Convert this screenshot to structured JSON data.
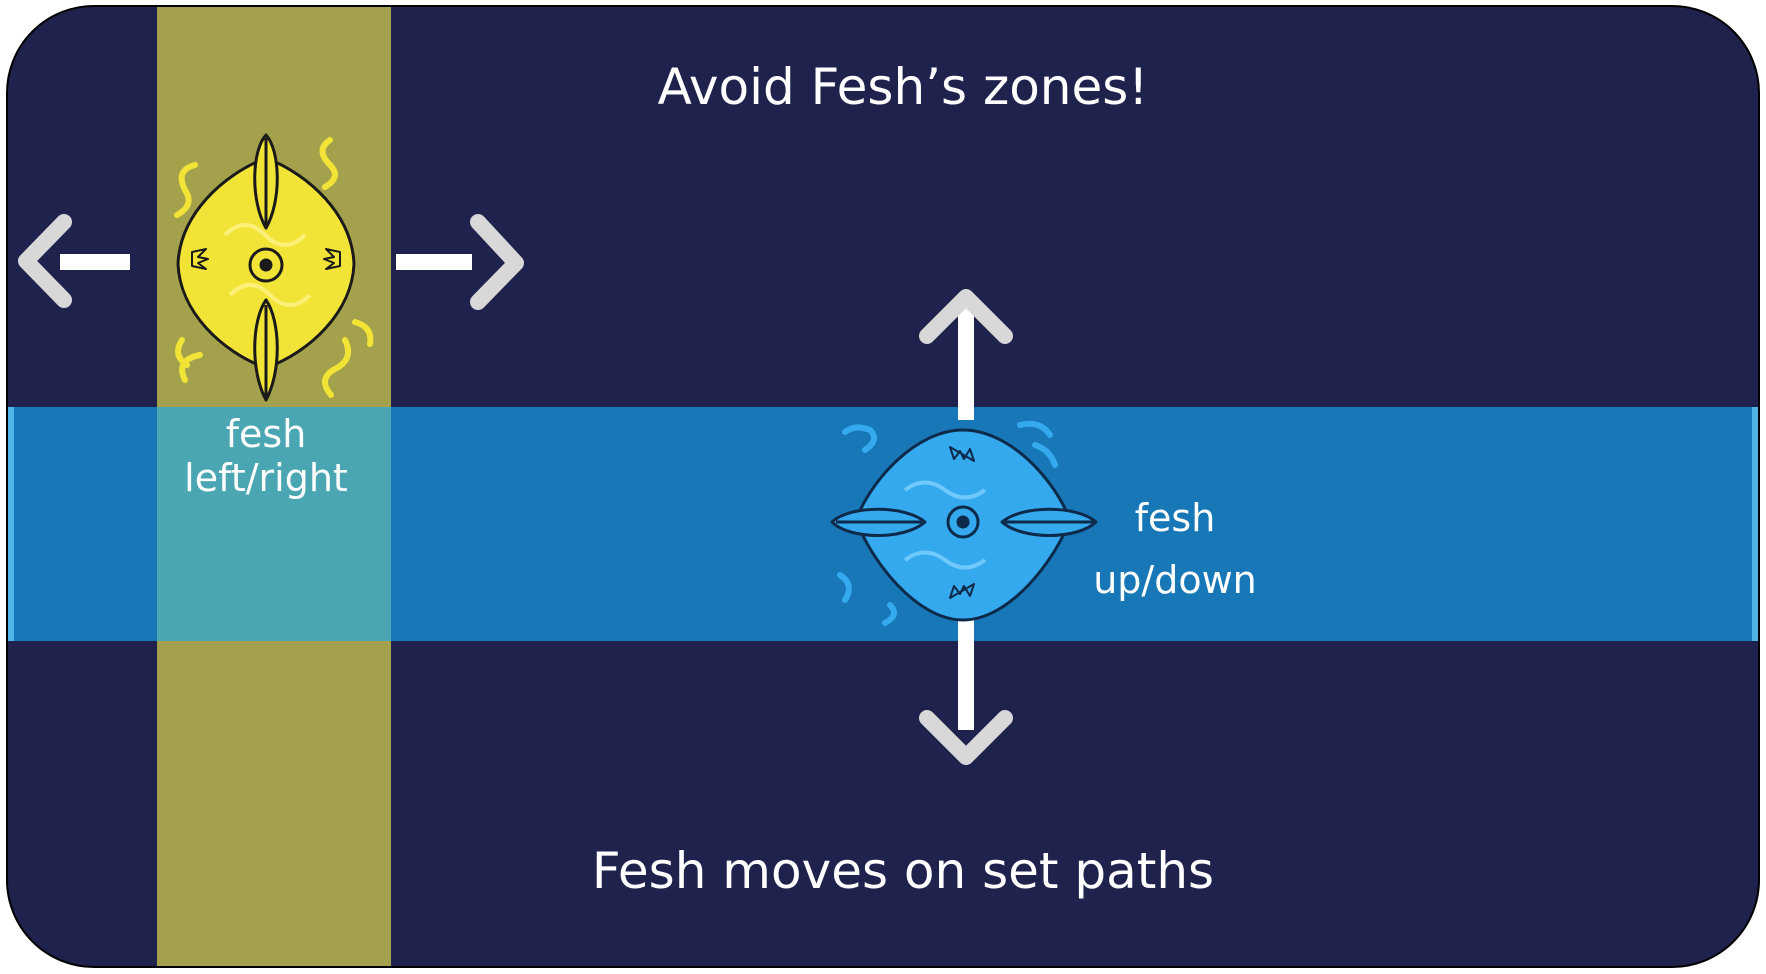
{
  "screen": {
    "title": "Avoid Fesh’s zones!",
    "subtitle": "Fesh moves on set paths"
  },
  "colors": {
    "background": "#1f224d",
    "yellow_zone": "#a4a14d",
    "blue_zone": "#1878b7",
    "yellow_fish": "#f2e437",
    "blue_fish": "#34a9ee",
    "arrow": "#ffffff"
  },
  "fish": [
    {
      "name": "yellow-fesh",
      "icon": "yellow-fish-icon",
      "label_line1": "fesh",
      "label_line2": "left/right",
      "movement": "horizontal"
    },
    {
      "name": "blue-fesh",
      "icon": "blue-fish-icon",
      "label_line1": "fesh",
      "label_line2": "up/down",
      "movement": "vertical"
    }
  ]
}
